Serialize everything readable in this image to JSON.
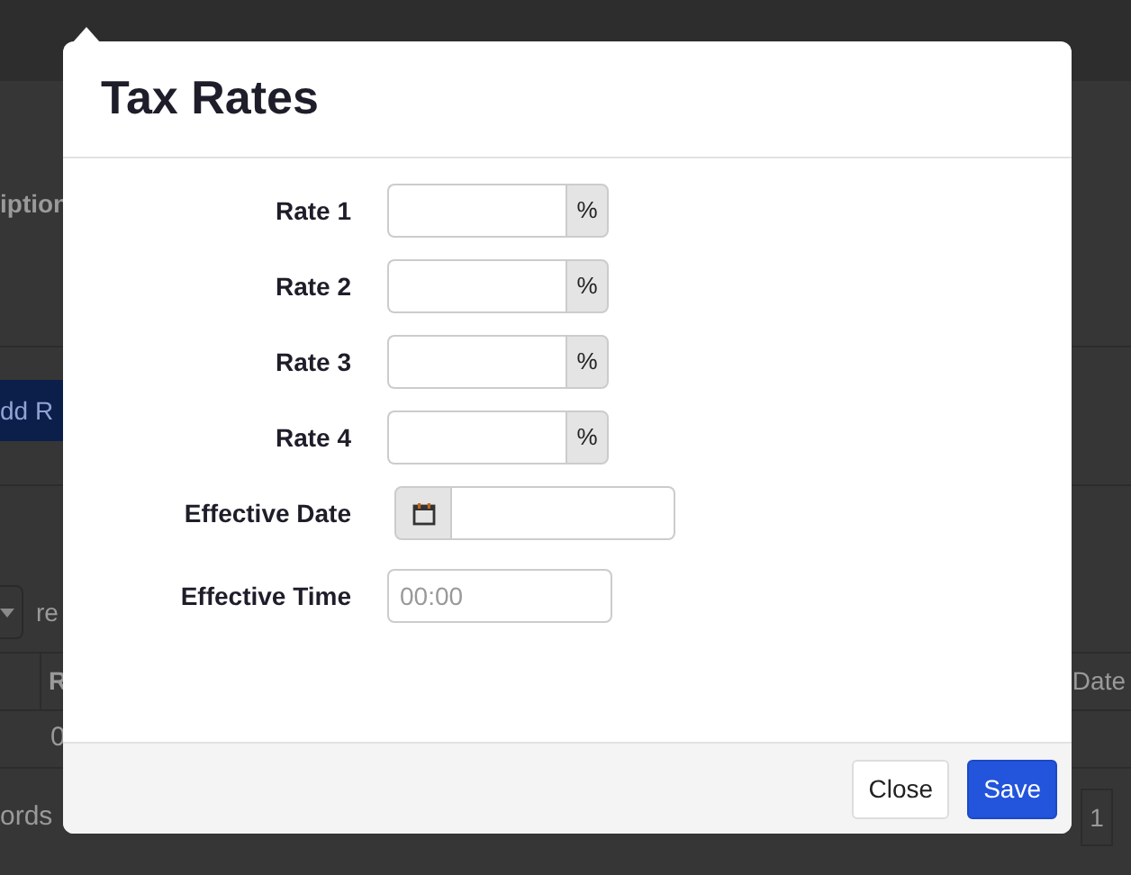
{
  "background": {
    "section_label": "iption",
    "add_button": "dd R",
    "select_label": "re",
    "table": {
      "columns": [
        "R",
        "Date"
      ],
      "rows": [
        [
          "0"
        ]
      ]
    },
    "footer_text": "ords",
    "pagination": [
      "1"
    ]
  },
  "modal": {
    "title": "Tax Rates",
    "rate_fields": [
      {
        "label": "Rate 1",
        "addon": "%"
      },
      {
        "label": "Rate 2",
        "addon": "%"
      },
      {
        "label": "Rate 3",
        "addon": "%"
      },
      {
        "label": "Rate 4",
        "addon": "%"
      }
    ],
    "date_field": {
      "label": "Effective Date"
    },
    "time_field": {
      "label": "Effective Time",
      "placeholder": "00:00"
    },
    "buttons": [
      {
        "label": "Close",
        "kind": "secondary"
      },
      {
        "label": "Save",
        "kind": "primary"
      }
    ]
  }
}
